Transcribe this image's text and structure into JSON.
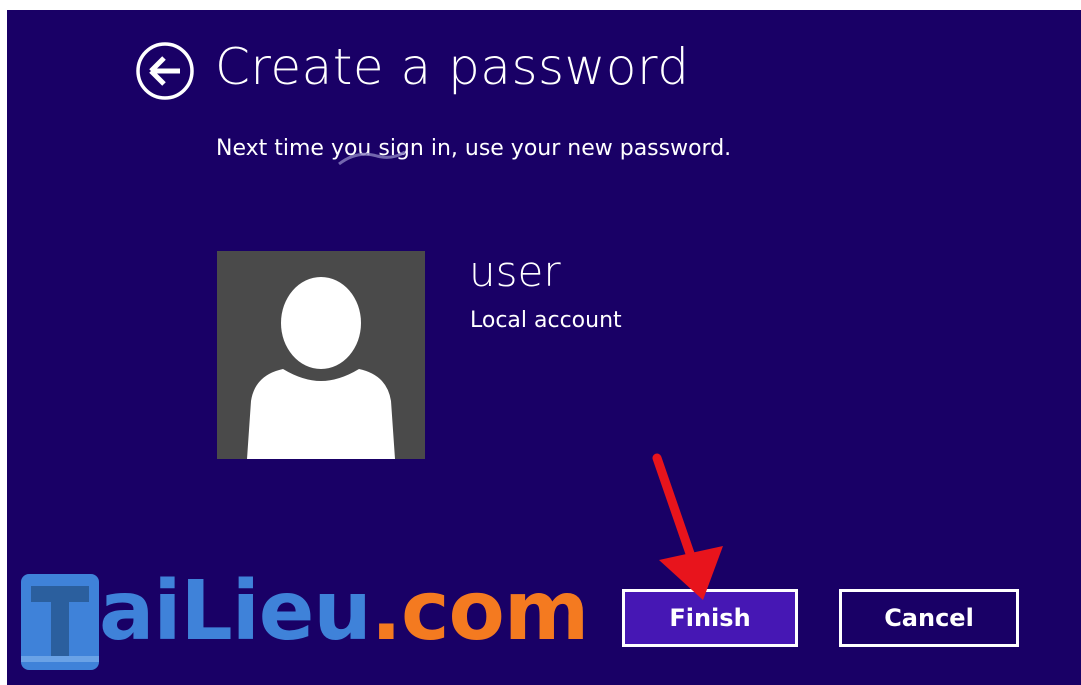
{
  "header": {
    "back_icon": "back-arrow-circle-icon",
    "title": "Create a password",
    "subtitle": "Next time you sign in, use your new password."
  },
  "account": {
    "avatar_icon": "user-silhouette-icon",
    "username": "user",
    "type": "Local account"
  },
  "buttons": {
    "finish_label": "Finish",
    "cancel_label": "Cancel"
  },
  "annotation": {
    "arrow_icon": "red-pointer-arrow-icon",
    "arrow_color": "#e8141c"
  },
  "watermark": {
    "brand_part1": "aiLieu",
    "brand_part2": ".com",
    "color_blue": "#3f82d9",
    "color_orange": "#f47a20"
  },
  "colors": {
    "background": "#190066",
    "finish_button": "#4617b4",
    "text": "#ffffff",
    "avatar_bg": "#4a4a4a"
  }
}
